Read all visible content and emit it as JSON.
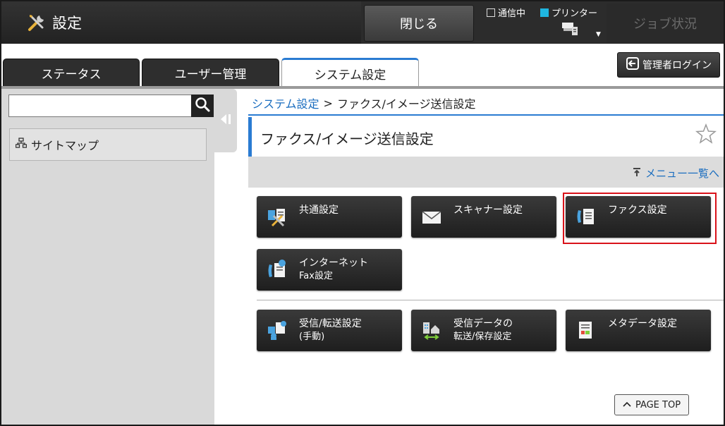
{
  "header": {
    "title": "設定",
    "close_label": "閉じる",
    "status_comm": "通信中",
    "status_printer": "プリンター",
    "job_status": "ジョブ状況"
  },
  "tabs": [
    {
      "label": "ステータス",
      "active": false
    },
    {
      "label": "ユーザー管理",
      "active": false
    },
    {
      "label": "システム設定",
      "active": true
    }
  ],
  "admin_login": "管理者ログイン",
  "sidebar": {
    "search_value": "",
    "sitemap_label": "サイトマップ"
  },
  "breadcrumb": {
    "parent": "システム設定",
    "separator": ">",
    "current": "ファクス/イメージ送信設定"
  },
  "page": {
    "title": "ファクス/イメージ送信設定",
    "menu_link": "メニュー一覧へ"
  },
  "tiles": [
    {
      "line1": "共通設定",
      "line2": "",
      "icon": "common-settings-icon"
    },
    {
      "line1": "スキャナー設定",
      "line2": "",
      "icon": "envelope-icon"
    },
    {
      "line1": "ファクス設定",
      "line2": "",
      "icon": "fax-icon",
      "highlighted": true
    },
    {
      "line1": "インターネット",
      "line2": "Fax設定",
      "icon": "internet-fax-icon"
    },
    {
      "line1": "受信/転送設定",
      "line2": "(手動)",
      "icon": "receive-forward-icon"
    },
    {
      "line1": "受信データの",
      "line2": "転送/保存設定",
      "icon": "data-forward-icon"
    },
    {
      "line1": "メタデータ設定",
      "line2": "",
      "icon": "metadata-icon"
    }
  ],
  "page_top": "PAGE TOP",
  "colors": {
    "accent": "#2a7bd2",
    "link": "#1a6dbf",
    "highlight": "#d9121a",
    "indicator": "#1fb6e0"
  }
}
